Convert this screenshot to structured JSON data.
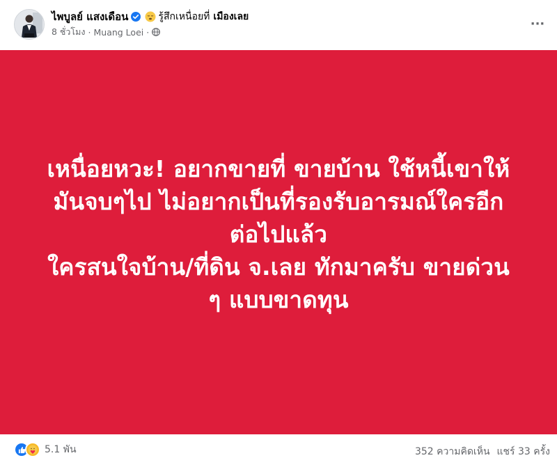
{
  "post": {
    "author": "ไพบูลย์ แสงเดือน",
    "verified": true,
    "feeling_emoji": "tired-face-emoji",
    "feeling_text": "รู้สึกเหนื่อยที่",
    "feeling_place": "เมืองเลย",
    "time": "8 ชั่วโมง",
    "separator": "·",
    "location": "Muang Loei",
    "privacy_icon": "globe-icon",
    "more_icon": "more-options-icon",
    "more_label": "···"
  },
  "card": {
    "background": "#de1d3b",
    "text_color": "#ffffff",
    "lines": [
      "เหนื่อยหวะ! อยากขายที่ ขายบ้าน ใช้หนี้เขาให้",
      "มันจบๆไป ไม่อยากเป็นที่รองรับอารมณ์ใครอีก",
      "ต่อไปแล้ว",
      "ใครสนใจบ้าน/ที่ดิน จ.เลย ทักมาครับ ขายด่วน",
      "ๆ แบบขาดทุน"
    ]
  },
  "footer": {
    "reaction_icons": [
      "like-icon",
      "care-icon"
    ],
    "reaction_count": "5.1 พัน",
    "comments": "352 ความคิดเห็น",
    "shares": "แชร์ 33 ครั้ง"
  }
}
